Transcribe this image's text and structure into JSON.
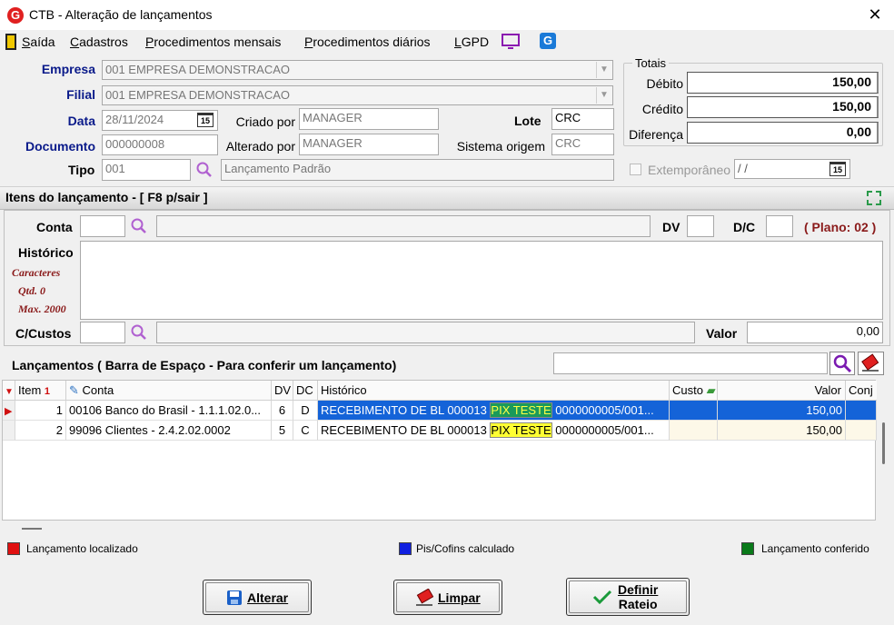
{
  "window": {
    "title": "CTB - Alteração de lançamentos",
    "logo": "G"
  },
  "menu": [
    {
      "label": "Saída",
      "u": "S",
      "rest": "aída"
    },
    {
      "label": "Cadastros",
      "u": "C",
      "rest": "adastros"
    },
    {
      "label": "Procedimentos mensais",
      "u": "P",
      "rest": "rocedimentos mensais"
    },
    {
      "label": "Procedimentos diários",
      "u": "P",
      "rest": "rocedimentos diários"
    },
    {
      "label": "LGPD",
      "u": "L",
      "rest": "GPD"
    }
  ],
  "header": {
    "empresa_label": "Empresa",
    "empresa_value": "001 EMPRESA DEMONSTRACAO",
    "filial_label": "Filial",
    "filial_value": "001 EMPRESA DEMONSTRACAO",
    "data_label": "Data",
    "data_value": "28/11/2024",
    "criado_label": "Criado por",
    "criado_value": "MANAGER",
    "lote_label": "Lote",
    "lote_value": "CRC",
    "documento_label": "Documento",
    "documento_value": "000000008",
    "alterado_label": "Alterado por",
    "alterado_value": "MANAGER",
    "sistema_label": "Sistema origem",
    "sistema_value": "CRC",
    "tipo_label": "Tipo",
    "tipo_value": "001",
    "tipo_desc": "Lançamento Padrão",
    "extemporaneo_label": "Extemporâneo",
    "extemporaneo_date": " / /",
    "cal_glyph": "15"
  },
  "totais": {
    "title": "Totais",
    "debito_label": "Débito",
    "debito_value": "150,00",
    "credito_label": "Crédito",
    "credito_value": "150,00",
    "diferenca_label": "Diferença",
    "diferenca_value": "0,00"
  },
  "itens": {
    "section_title": "Itens do lançamento - [ F8 p/sair ]",
    "conta_label": "Conta",
    "dv_label": "DV",
    "dc_label": "D/C",
    "plano": "( Plano: 02 )",
    "historico_label": "Histórico",
    "caracteres": "Caracteres",
    "qtd": "Qtd. 0",
    "max": "Max. 2000",
    "ccustos_label": "C/Custos",
    "valor_label": "Valor",
    "valor_value": "0,00"
  },
  "lancamentos": {
    "title": "Lançamentos ( Barra de Espaço - Para conferir um lançamento)",
    "columns": [
      "Item",
      "Conta",
      "DV",
      "DC",
      "Histórico",
      "Custo",
      "Valor",
      "Conj"
    ],
    "sort_marker": "1",
    "rows": [
      {
        "item": "1",
        "conta": "00106 Banco do Brasil - 1.1.1.02.0...",
        "dv": "6",
        "dc": "D",
        "hist_a": "RECEBIMENTO DE BL 000013 ",
        "hist_pix": "PIX TESTE",
        "hist_b": " 0000000005/001...",
        "custo": "",
        "valor": "150,00",
        "conj": ""
      },
      {
        "item": "2",
        "conta": "99096 Clientes - 2.4.2.02.0002",
        "dv": "5",
        "dc": "C",
        "hist_a": "RECEBIMENTO DE BL 000013 ",
        "hist_pix": "PIX TESTE",
        "hist_b": " 0000000005/001...",
        "custo": "",
        "valor": "150,00",
        "conj": ""
      }
    ]
  },
  "legend": {
    "localizado": "Lançamento localizado",
    "localizado_color": "#e01010",
    "pis": "Pis/Cofins calculado",
    "pis_color": "#1020e0",
    "conferido": "Lançamento conferido",
    "conferido_color": "#0a7a1a"
  },
  "buttons": {
    "alterar": "Alterar",
    "limpar": "Limpar",
    "definir_1": "Definir",
    "definir_2": "Rateio"
  }
}
